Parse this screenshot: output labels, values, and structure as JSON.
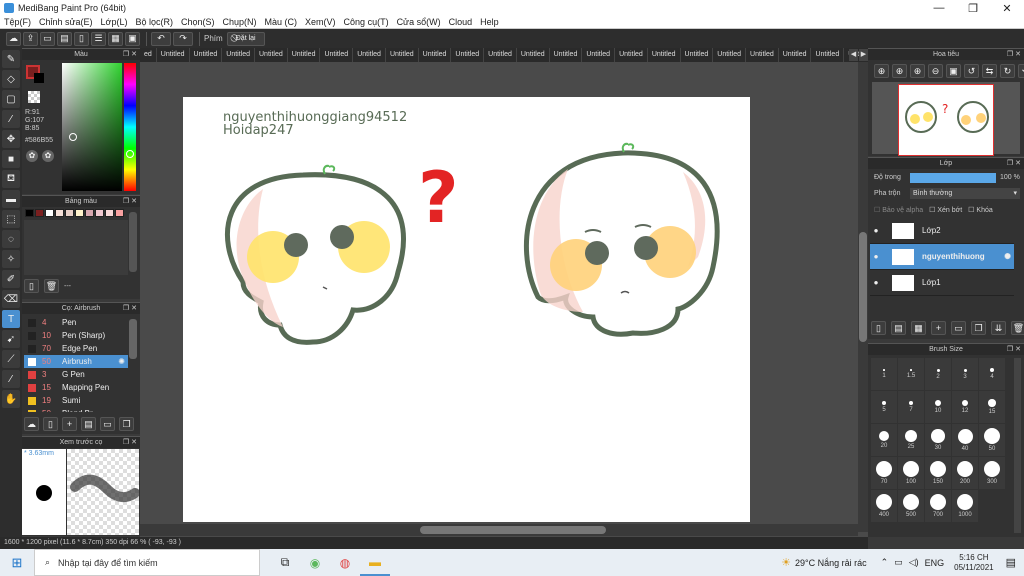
{
  "window": {
    "title": "MediBang Paint Pro (64bit)",
    "minimize": "—",
    "maximize": "❐",
    "close": "✕"
  },
  "menu": [
    "Tệp(F)",
    "Chỉnh sửa(E)",
    "Lớp(L)",
    "Bộ lọc(R)",
    "Chọn(S)",
    "Chụp(N)",
    "Màu (C)",
    "Xem(V)",
    "Công cụ(T)",
    "Cửa sổ(W)",
    "Cloud",
    "Help"
  ],
  "toolbar": {
    "phim_label": "Phím",
    "reset_label": "Đặt lại"
  },
  "tabs": {
    "first": "ed",
    "items": [
      "Untitled",
      "Untitled",
      "Untitled",
      "Untitled",
      "Untitled",
      "Untitled",
      "Untitled",
      "Untitled",
      "Untitled",
      "Untitled",
      "Untitled",
      "Untitled",
      "Untitled",
      "Untitled",
      "Untitled",
      "Untitled",
      "Untitled",
      "Untitled",
      "Untitled",
      "Untitled",
      "Untitled",
      "Untitled",
      "Untitled",
      "Untitled"
    ]
  },
  "color_panel": {
    "title": "Màu",
    "r": "R:91",
    "g": "G:107",
    "b": "B:85",
    "hex": "#586B55",
    "current": "#586B55"
  },
  "palette_panel": {
    "title": "Bảng màu",
    "footer": "---",
    "colors": [
      "#000000",
      "#7a1f1f",
      "#ffffff",
      "#f5e0d8",
      "#e8d0c8",
      "#fff2cc",
      "#d8a8b0",
      "#f0c8d0",
      "#f8d8d8",
      "#f8a0a0"
    ]
  },
  "brush_panel": {
    "title": "Cọ: Airbrush",
    "items": [
      {
        "size": "4",
        "name": "Pen",
        "color": "#222222"
      },
      {
        "size": "10",
        "name": "Pen (Sharp)",
        "color": "#222222"
      },
      {
        "size": "70",
        "name": "Edge Pen",
        "color": "#222222"
      },
      {
        "size": "50",
        "name": "Airbrush",
        "color": "#ffffff",
        "active": true
      },
      {
        "size": "3",
        "name": "G Pen",
        "color": "#e04040"
      },
      {
        "size": "15",
        "name": "Mapping Pen",
        "color": "#e04040"
      },
      {
        "size": "19",
        "name": "Sumi",
        "color": "#f0c020"
      },
      {
        "size": "50",
        "name": "Blend Br",
        "color": "#f0c020"
      }
    ]
  },
  "preview_panel": {
    "title": "Xem trước cọ",
    "size": "* 3.63mm"
  },
  "navigator_panel": {
    "title": "Hoa tiêu"
  },
  "layer_panel": {
    "title": "Lớp",
    "opacity_label": "Độ trong",
    "opacity_value": "100 %",
    "opacity_fraction": 1.0,
    "blend_label": "Pha trộn",
    "blend_value": "Bình thường",
    "protect_alpha": "Bảo vệ alpha",
    "clipping": "Xén bớt",
    "lock": "Khóa",
    "layers": [
      {
        "name": "Lớp2",
        "active": false
      },
      {
        "name": "nguyenthihuong",
        "active": true
      },
      {
        "name": "Lớp1",
        "active": false
      }
    ]
  },
  "brushsize_panel": {
    "title": "Brush Size",
    "rows": [
      [
        {
          "v": "1"
        },
        {
          "v": "1.5"
        },
        {
          "v": "2"
        },
        {
          "v": "3"
        },
        {
          "v": "4"
        }
      ],
      [
        {
          "v": "5"
        },
        {
          "v": "7"
        },
        {
          "v": "10"
        },
        {
          "v": "12"
        },
        {
          "v": "15"
        }
      ],
      [
        {
          "v": "20"
        },
        {
          "v": "25"
        },
        {
          "v": "30"
        },
        {
          "v": "40"
        },
        {
          "v": "50"
        }
      ],
      [
        {
          "v": "70"
        },
        {
          "v": "100"
        },
        {
          "v": "150"
        },
        {
          "v": "200"
        },
        {
          "v": "300"
        }
      ],
      [
        {
          "v": "400"
        },
        {
          "v": "500"
        },
        {
          "v": "700"
        },
        {
          "v": "1000"
        }
      ]
    ]
  },
  "canvas": {
    "text1": "nguyenthihuonggiang94512",
    "text2": "Hoidap247",
    "question": "?"
  },
  "status": {
    "text": "1600 * 1200 pixel    (11.6 * 8.7cm)   350 dpi   66 %   ( -93, -93 )"
  },
  "taskbar": {
    "search_placeholder": "Nhập tại đây để tìm kiếm",
    "weather": "29°C  Nắng rải rác",
    "lang": "ENG",
    "time": "5:16 CH",
    "date": "05/11/2021"
  }
}
